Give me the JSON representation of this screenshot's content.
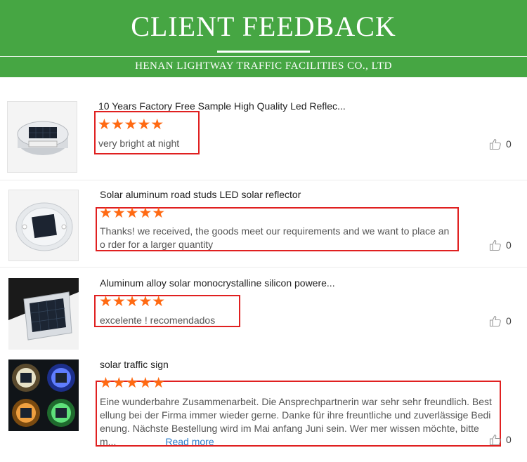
{
  "banner": {
    "title": "CLIENT FEEDBACK",
    "subtitle": "HENAN LIGHTWAY TRAFFIC FACILITIES CO., LTD"
  },
  "colors": {
    "banner": "#46a643",
    "star": "#ff6a13",
    "highlight_box": "#e02020",
    "link": "#2b7bc9"
  },
  "reviews": [
    {
      "title": "10 Years Factory Free Sample High Quality Led Reflec...",
      "rating": 5,
      "stars": "★★★★★",
      "comment": "very bright at night",
      "likes": "0"
    },
    {
      "title": "Solar aluminum road studs LED solar reflector",
      "rating": 5,
      "stars": "★★★★★",
      "comment": "Thanks! we received, the goods meet our requirements and we want to place an o rder for a larger quantity",
      "likes": "0"
    },
    {
      "title": "Aluminum alloy solar monocrystalline silicon powere...",
      "rating": 5,
      "stars": "★★★★★",
      "comment": "excelente ! recomendados",
      "likes": "0"
    },
    {
      "title": "solar traffic sign",
      "rating": 5,
      "stars": "★★★★★",
      "comment": "Eine wunderbahre Zusammenarbeit. Die Ansprechpartnerin war sehr sehr freundlich. Bestellung bei der Firma immer wieder gerne. Danke für ihre freuntliche und zuverlässige Bedienung. Nächste Bestellung wird im Mai anfang Juni sein. Wer mer wissen möchte, bitte m...",
      "read_more": "Read more",
      "likes": "0"
    }
  ],
  "icons": {
    "like": "thumbs-up-icon"
  }
}
